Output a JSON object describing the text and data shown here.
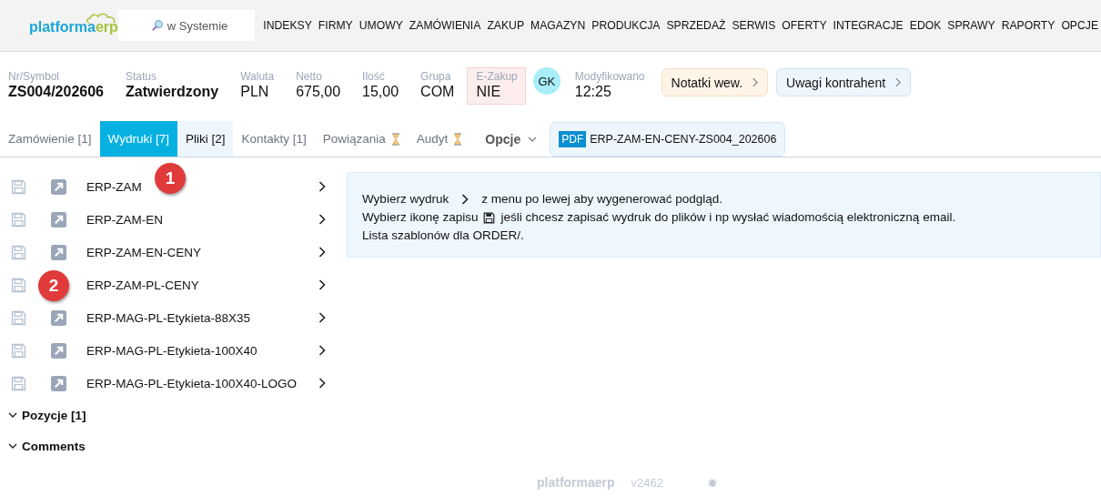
{
  "logo": {
    "main": "platforma",
    "accent": "erp"
  },
  "search": {
    "placeholder": "w Systemie"
  },
  "nav": [
    "INDEKSY",
    "FIRMY",
    "UMOWY",
    "ZAMÓWIENIA",
    "ZAKUP",
    "MAGAZYN",
    "PRODUKCJA",
    "SPRZEDAŻ",
    "SERWIS",
    "OFERTY",
    "INTEGRACJE",
    "EDOK",
    "SPRAWY",
    "RAPORTY",
    "OPCJE"
  ],
  "fields": [
    {
      "label": "Nr/Symbol",
      "value": "ZS004/202606",
      "bold": true,
      "highlighted": false
    },
    {
      "label": "Status",
      "value": "Zatwierdzony",
      "bold": true,
      "highlighted": false
    },
    {
      "label": "Waluta",
      "value": "PLN",
      "bold": false,
      "highlighted": false
    },
    {
      "label": "Netto",
      "value": "675,00",
      "bold": false,
      "highlighted": false
    },
    {
      "label": "Ilość",
      "value": "15,00",
      "bold": false,
      "highlighted": false
    },
    {
      "label": "Grupa",
      "value": "COM",
      "bold": false,
      "highlighted": false
    },
    {
      "label": "E-Zakup",
      "value": "NIE",
      "bold": false,
      "highlighted": true
    }
  ],
  "avatar": "GK",
  "modified": {
    "label": "Modyfikowano",
    "value": "12:25"
  },
  "note_buttons": [
    {
      "label": "Notatki wew.",
      "color": "#fff4e8"
    },
    {
      "label": "Uwagi kontrahent",
      "color": "#eef6fd"
    }
  ],
  "tabs": [
    {
      "label": "Zamówienie [1]",
      "selected": false,
      "highlighted": false,
      "loading": false
    },
    {
      "label": "Wydruki [7]",
      "selected": true,
      "highlighted": false,
      "loading": false
    },
    {
      "label": "Pliki [2]",
      "selected": false,
      "highlighted": true,
      "loading": false
    },
    {
      "label": "Kontakty [1]",
      "selected": false,
      "highlighted": false,
      "loading": false
    },
    {
      "label": "Powiązania",
      "selected": false,
      "highlighted": false,
      "loading": true
    },
    {
      "label": "Audyt",
      "selected": false,
      "highlighted": false,
      "loading": true
    }
  ],
  "options_menu": "Opcje",
  "pdf_chip": {
    "badge": "PDF",
    "label": "ERP-ZAM-EN-CENY-ZS004_202606"
  },
  "prints": [
    {
      "name": "ERP-ZAM",
      "callout": {
        "label": "1",
        "kind": "inline"
      }
    },
    {
      "name": "ERP-ZAM-EN"
    },
    {
      "name": "ERP-ZAM-EN-CENY"
    },
    {
      "name": "ERP-ZAM-PL-CENY",
      "callout": {
        "label": "2",
        "kind": "overlay"
      }
    },
    {
      "name": "ERP-MAG-PL-Etykieta-88X35"
    },
    {
      "name": "ERP-MAG-PL-Etykieta-100X40"
    },
    {
      "name": "ERP-MAG-PL-Etykieta-100X40-LOGO"
    }
  ],
  "sections": [
    "Pozycje [1]",
    "Comments"
  ],
  "info": [
    {
      "kind": "chevron",
      "before": "Wybierz wydruk",
      "after": "z menu po lewej aby wygenerować podgląd."
    },
    {
      "kind": "save",
      "before": "Wybierz ikonę zapisu",
      "after": "jeśli chcesz zapisać wydruk do plików i np wysłać wiadomością elektroniczną email."
    },
    {
      "kind": "plain",
      "before": "Lista szablonów dla ORDER/."
    }
  ],
  "footer": {
    "logo_main": "platforma",
    "logo_accent": "erp",
    "version": "v2462"
  }
}
